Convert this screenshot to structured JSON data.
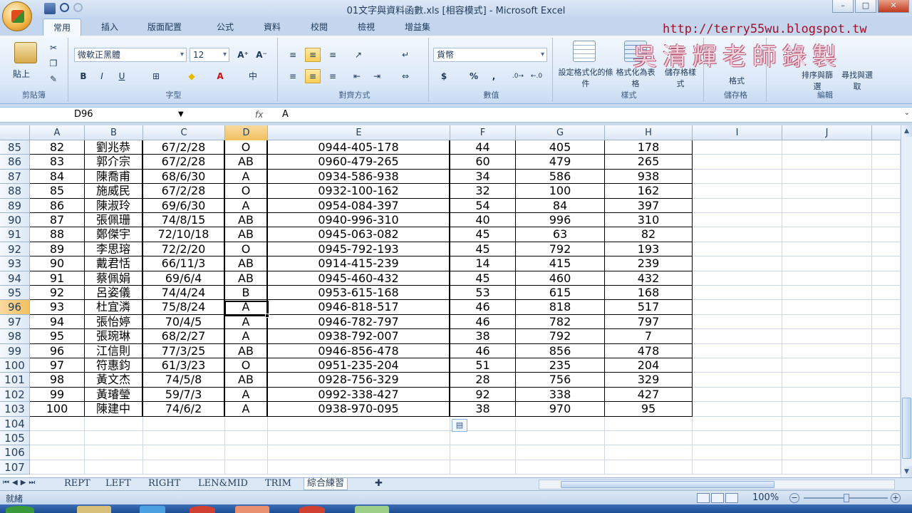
{
  "window": {
    "title": "01文字與資料函數.xls [相容模式] - Microsoft Excel",
    "min": "–",
    "max": "□",
    "close": "✕"
  },
  "ribbon_tabs": [
    "常用",
    "插入",
    "版面配置",
    "公式",
    "資料",
    "校閱",
    "檢視",
    "增益集"
  ],
  "watermark": {
    "url": "http://terry55wu.blogspot.tw",
    "author": "吳清輝老師錄製"
  },
  "clipboard": {
    "label": "剪貼簿",
    "paste": "貼上"
  },
  "font": {
    "label": "字型",
    "name": "微軟正黑體",
    "size": "12",
    "bold": "B",
    "italic": "I",
    "underline": "U",
    "grow": "A⁺",
    "shrink": "A⁻",
    "font_color": "A"
  },
  "alignment": {
    "label": "對齊方式"
  },
  "number": {
    "label": "數值",
    "format": "貨幣",
    "currency": "$",
    "percent": "%",
    "comma": ","
  },
  "styles": {
    "label": "樣式",
    "cond_format": "設定格式化的條件",
    "table_format": "格式化為表格",
    "cell_styles": "儲存格樣式"
  },
  "cells": {
    "label": "儲存格",
    "format": "格式"
  },
  "editing": {
    "label": "編輯",
    "sort_filter": "排序與篩選",
    "find_select": "尋找與選取"
  },
  "formula_bar": {
    "name_box": "D96",
    "fx": "fx",
    "value": "A"
  },
  "columns": [
    "A",
    "B",
    "C",
    "D",
    "E",
    "F",
    "G",
    "H",
    "I",
    "J"
  ],
  "selected_column": "D",
  "selected_row": "96",
  "rows": [
    {
      "r": "85",
      "cells": [
        "82",
        "劉兆恭",
        "67/2/28",
        "O",
        "0944-405-178",
        "44",
        "405",
        "178"
      ]
    },
    {
      "r": "86",
      "cells": [
        "83",
        "郭介宗",
        "67/2/28",
        "AB",
        "0960-479-265",
        "60",
        "479",
        "265"
      ]
    },
    {
      "r": "87",
      "cells": [
        "84",
        "陳喬甫",
        "68/6/30",
        "A",
        "0934-586-938",
        "34",
        "586",
        "938"
      ]
    },
    {
      "r": "88",
      "cells": [
        "85",
        "施威民",
        "67/2/28",
        "O",
        "0932-100-162",
        "32",
        "100",
        "162"
      ]
    },
    {
      "r": "89",
      "cells": [
        "86",
        "陳淑玲",
        "69/6/30",
        "A",
        "0954-084-397",
        "54",
        "84",
        "397"
      ]
    },
    {
      "r": "90",
      "cells": [
        "87",
        "張佩珊",
        "74/8/15",
        "AB",
        "0940-996-310",
        "40",
        "996",
        "310"
      ]
    },
    {
      "r": "91",
      "cells": [
        "88",
        "鄭傑宇",
        "72/10/18",
        "AB",
        "0945-063-082",
        "45",
        "63",
        "82"
      ]
    },
    {
      "r": "92",
      "cells": [
        "89",
        "李思瑢",
        "72/2/20",
        "O",
        "0945-792-193",
        "45",
        "792",
        "193"
      ]
    },
    {
      "r": "93",
      "cells": [
        "90",
        "戴君恬",
        "66/11/3",
        "AB",
        "0914-415-239",
        "14",
        "415",
        "239"
      ]
    },
    {
      "r": "94",
      "cells": [
        "91",
        "蔡佩娟",
        "69/6/4",
        "AB",
        "0945-460-432",
        "45",
        "460",
        "432"
      ]
    },
    {
      "r": "95",
      "cells": [
        "92",
        "呂姿儀",
        "74/4/24",
        "B",
        "0953-615-168",
        "53",
        "615",
        "168"
      ]
    },
    {
      "r": "96",
      "cells": [
        "93",
        "杜宜潾",
        "75/8/24",
        "A",
        "0946-818-517",
        "46",
        "818",
        "517"
      ]
    },
    {
      "r": "97",
      "cells": [
        "94",
        "張怡婷",
        "70/4/5",
        "A",
        "0946-782-797",
        "46",
        "782",
        "797"
      ]
    },
    {
      "r": "98",
      "cells": [
        "95",
        "張琬琳",
        "68/2/27",
        "A",
        "0938-792-007",
        "38",
        "792",
        "7"
      ]
    },
    {
      "r": "99",
      "cells": [
        "96",
        "江信則",
        "77/3/25",
        "AB",
        "0946-856-478",
        "46",
        "856",
        "478"
      ]
    },
    {
      "r": "100",
      "cells": [
        "97",
        "符惠鈞",
        "61/3/23",
        "O",
        "0951-235-204",
        "51",
        "235",
        "204"
      ]
    },
    {
      "r": "101",
      "cells": [
        "98",
        "黃文杰",
        "74/5/8",
        "AB",
        "0928-756-329",
        "28",
        "756",
        "329"
      ]
    },
    {
      "r": "102",
      "cells": [
        "99",
        "黃璿瑩",
        "59/7/3",
        "A",
        "0992-338-427",
        "92",
        "338",
        "427"
      ]
    },
    {
      "r": "103",
      "cells": [
        "100",
        "陳建中",
        "74/6/2",
        "A",
        "0938-970-095",
        "38",
        "970",
        "95"
      ]
    },
    {
      "r": "104",
      "cells": []
    },
    {
      "r": "105",
      "cells": []
    },
    {
      "r": "106",
      "cells": []
    },
    {
      "r": "107",
      "cells": []
    }
  ],
  "sheet_tabs": [
    "REPT",
    "LEFT",
    "RIGHT",
    "LEN&MID",
    "TRIM",
    "綜合練習"
  ],
  "active_sheet": "綜合練習",
  "status": {
    "ready": "就緒",
    "zoom": "100%"
  }
}
